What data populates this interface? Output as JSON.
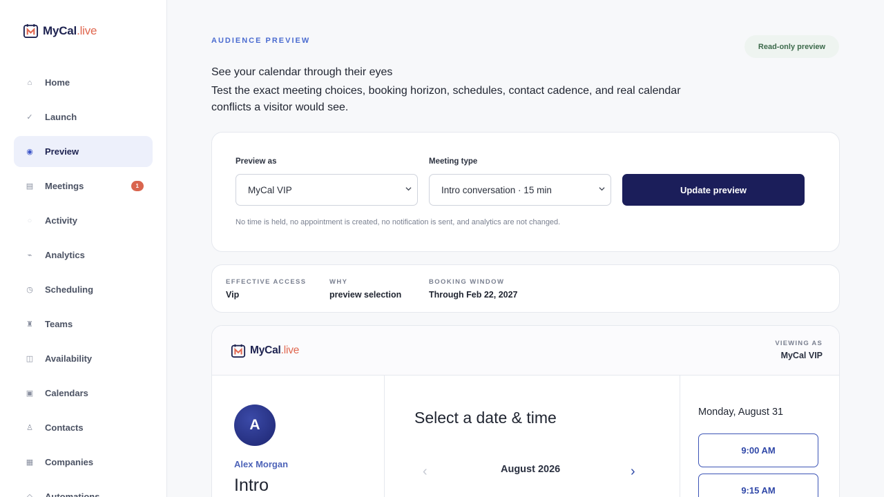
{
  "brand": {
    "name_main": "MyCal",
    "name_accent": ".live"
  },
  "sidebar": {
    "items": [
      {
        "label": "Home",
        "icon": "home-icon",
        "glyph": "⌂"
      },
      {
        "label": "Launch",
        "icon": "check-icon",
        "glyph": "✓"
      },
      {
        "label": "Preview",
        "icon": "preview-dot-icon",
        "glyph": "◉",
        "active": true
      },
      {
        "label": "Meetings",
        "icon": "meetings-icon",
        "glyph": "▤",
        "badge": "1"
      },
      {
        "label": "Activity",
        "icon": "activity-icon",
        "glyph": "○"
      },
      {
        "label": "Analytics",
        "icon": "analytics-icon",
        "glyph": "⌁"
      },
      {
        "label": "Scheduling",
        "icon": "clock-icon",
        "glyph": "◷"
      },
      {
        "label": "Teams",
        "icon": "teams-icon",
        "glyph": "♜"
      },
      {
        "label": "Availability",
        "icon": "availability-icon",
        "glyph": "◫"
      },
      {
        "label": "Calendars",
        "icon": "calendar-icon",
        "glyph": "▣"
      },
      {
        "label": "Contacts",
        "icon": "contacts-icon",
        "glyph": "♙"
      },
      {
        "label": "Companies",
        "icon": "companies-icon",
        "glyph": "▦"
      },
      {
        "label": "Automations",
        "icon": "automations-icon",
        "glyph": "◇"
      }
    ]
  },
  "main": {
    "eyebrow": "AUDIENCE PREVIEW",
    "badge": "Read-only preview",
    "headline": "See your calendar through their eyes",
    "description": "Test the exact meeting choices, booking horizon, schedules, contact cadence, and real calendar conflicts a visitor would see."
  },
  "form": {
    "preview_as_label": "Preview as",
    "preview_as_value": "MyCal VIP",
    "meeting_type_label": "Meeting type",
    "meeting_type_value": "Intro conversation · 15 min",
    "update_button": "Update preview",
    "note": "No time is held, no appointment is created, no notification is sent, and analytics are not changed."
  },
  "info": {
    "effective_access_label": "EFFECTIVE ACCESS",
    "effective_access_value": "Vip",
    "why_label": "WHY",
    "why_value": "preview selection",
    "booking_window_label": "BOOKING WINDOW",
    "booking_window_value": "Through Feb 22, 2027"
  },
  "preview": {
    "viewing_as_label": "VIEWING AS",
    "viewing_as_value": "MyCal VIP",
    "avatar_initial": "A",
    "host_name": "Alex Morgan",
    "event_title": "Intro",
    "select_title": "Select a date & time",
    "month": "August 2026",
    "prev_glyph": "‹",
    "next_glyph": "›",
    "day": "Monday, August 31",
    "slots": [
      "9:00 AM",
      "9:15 AM"
    ]
  },
  "colors": {
    "primary": "#1b1e5a",
    "accent": "#e0674f",
    "link": "#3b53b5"
  }
}
